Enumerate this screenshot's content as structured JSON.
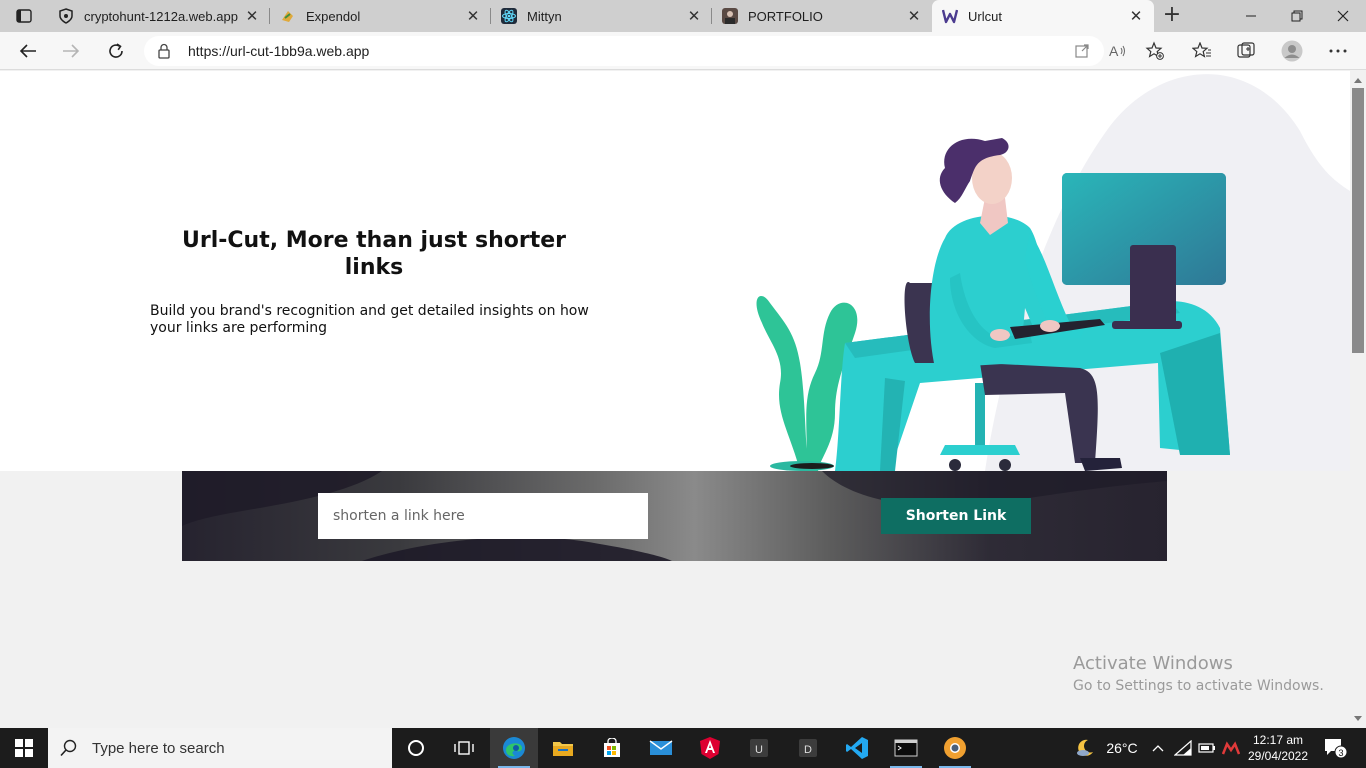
{
  "browser": {
    "tabs": [
      {
        "title": "cryptohunt-1212a.web.app",
        "favicon": "shield-icon"
      },
      {
        "title": "Expendol",
        "favicon": "money-icon"
      },
      {
        "title": "Mittyn",
        "favicon": "react-icon"
      },
      {
        "title": "PORTFOLIO",
        "favicon": "portrait-icon"
      },
      {
        "title": "Urlcut",
        "favicon": "w-logo-icon",
        "active": true
      }
    ],
    "url": "https://url-cut-1bb9a.web.app"
  },
  "page": {
    "hero_title": "Url-Cut, More than just shorter links",
    "hero_subtitle": "Build you brand's recognition and get detailed insights on how your links are performing",
    "input_placeholder": "shorten a link here",
    "button_label": "Shorten Link",
    "colors": {
      "button": "#0e6e62",
      "accent_teal": "#2ccfcf",
      "hair": "#4b2f6b",
      "plant": "#2ec497"
    }
  },
  "watermark": {
    "line1": "Activate Windows",
    "line2": "Go to Settings to activate Windows."
  },
  "taskbar": {
    "search_placeholder": "Type here to search",
    "apps": [
      "cortana-icon",
      "task-view-icon",
      "edge-icon",
      "file-explorer-icon",
      "store-icon",
      "mail-icon",
      "angular-icon",
      "u-app-icon",
      "d-app-icon",
      "vscode-icon",
      "terminal-icon",
      "chrome-canary-icon"
    ],
    "weather": "26°C",
    "time": "12:17 am",
    "date": "29/04/2022",
    "notifications": "3"
  }
}
